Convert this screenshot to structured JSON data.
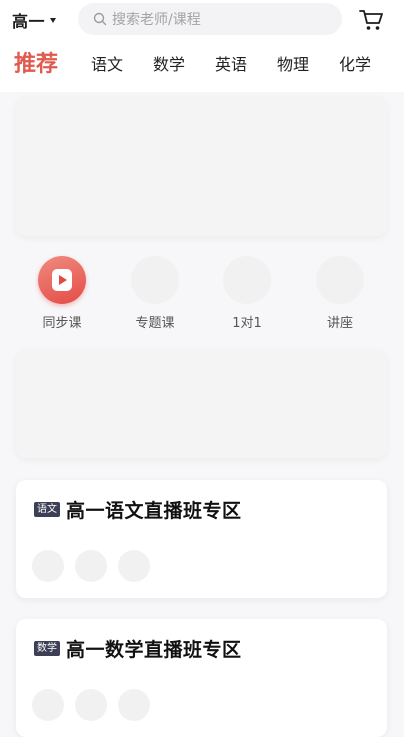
{
  "header": {
    "grade": "高一",
    "search_placeholder": "搜索老师/课程",
    "icons": {
      "grade_dropdown": "caret-down-icon",
      "search": "search-icon",
      "cart": "shopping-cart-icon"
    }
  },
  "tabs": {
    "active": "推荐",
    "items": [
      "推荐",
      "语文",
      "数学",
      "英语",
      "物理",
      "化学"
    ]
  },
  "quick_nav": {
    "items": [
      {
        "label": "同步课",
        "icon": "play-video-icon"
      },
      {
        "label": "专题课",
        "icon": ""
      },
      {
        "label": "1对1",
        "icon": ""
      },
      {
        "label": "讲座",
        "icon": ""
      }
    ]
  },
  "sections": [
    {
      "tag": "语文",
      "title": "高一语文直播班专区"
    },
    {
      "tag": "数学",
      "title": "高一数学直播班专区"
    }
  ],
  "colors": {
    "accent": "#e05a4f",
    "tag_bg": "#3c3f55",
    "page_bg": "#f7f7f9"
  }
}
